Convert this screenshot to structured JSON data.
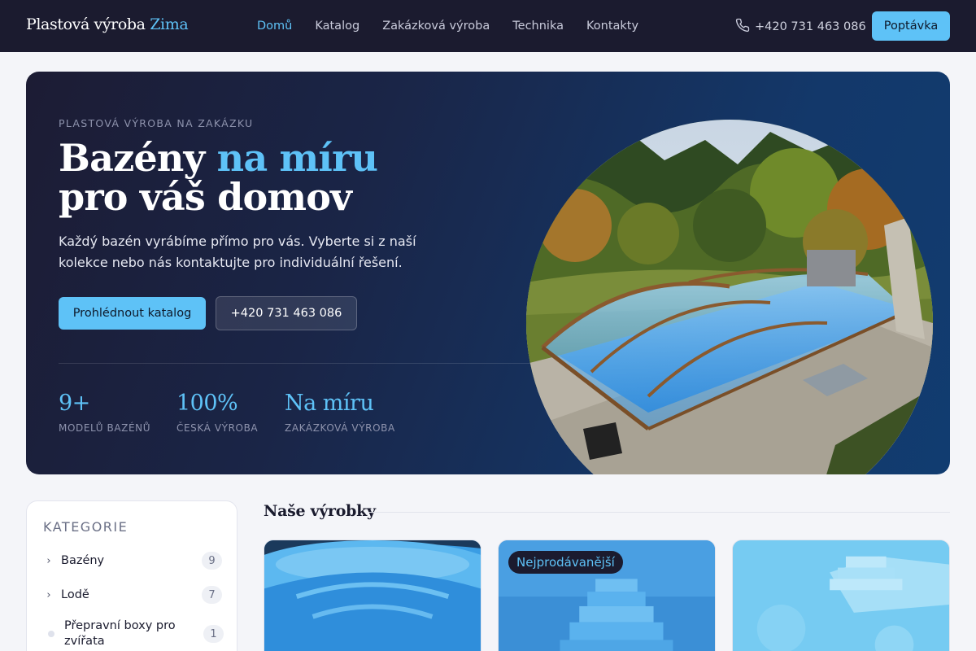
{
  "header": {
    "logo_main": "Plastová výroba",
    "logo_accent": "Zima",
    "nav": [
      {
        "label": "Domů",
        "active": true
      },
      {
        "label": "Katalog",
        "active": false
      },
      {
        "label": "Zakázková výroba",
        "active": false
      },
      {
        "label": "Technika",
        "active": false
      },
      {
        "label": "Kontakty",
        "active": false
      }
    ],
    "phone": "+420 731 463 086",
    "cta_label": "Poptávka"
  },
  "hero": {
    "eyebrow": "PLASTOVÁ VÝROBA NA ZAKÁZKU",
    "title_line1_start": "Bazény",
    "title_line1_accent": "na míru",
    "title_line2": "pro váš domov",
    "description": "Každý bazén vyrábíme přímo pro vás. Vyberte si z naší kolekce nebo nás kontaktujte pro individuální řešení.",
    "primary_button": "Prohlédnout katalog",
    "secondary_button": "+420 731 463 086",
    "stats": [
      {
        "value": "9+",
        "label": "MODELŮ BAZÉNŮ"
      },
      {
        "value": "100%",
        "label": "ČESKÁ VÝROBA"
      },
      {
        "value": "Na míru",
        "label": "ZAKÁZKOVÁ VÝROBA"
      }
    ]
  },
  "sidebar": {
    "title": "KATEGORIE",
    "items": [
      {
        "label": "Bazény",
        "count": "9",
        "expandable": true
      },
      {
        "label": "Lodě",
        "count": "7",
        "expandable": true
      },
      {
        "label": "Přepravní boxy pro zvířata",
        "count": "1",
        "expandable": false
      }
    ]
  },
  "products": {
    "section_title": "Naše výrobky",
    "cards": [
      {
        "badge": ""
      },
      {
        "badge": "Nejprodávanější"
      },
      {
        "badge": ""
      }
    ]
  },
  "colors": {
    "accent": "#5ec2f7",
    "header_bg": "#1b1b2f",
    "page_bg": "#f4f5f9"
  }
}
